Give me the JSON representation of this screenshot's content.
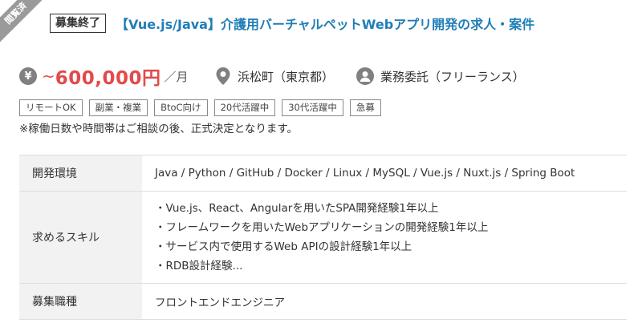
{
  "ribbon": {
    "label": "閲覧済"
  },
  "header": {
    "closed_badge": "募集終了",
    "title": "【Vue.js/Java】介護用バーチャルペットWebアプリ開発の求人・案件"
  },
  "meta": {
    "currency_icon_glyph": "¥",
    "salary_prefix": "~",
    "salary_amount": "600,000円",
    "salary_unit": "／月",
    "location": "浜松町（東京都）",
    "contract_type": "業務委託（フリーランス）",
    "icons": [
      "yen-icon",
      "location-pin-icon",
      "person-icon"
    ]
  },
  "tags": [
    "リモートOK",
    "副業・複業",
    "BtoC向け",
    "20代活躍中",
    "30代活躍中",
    "急募"
  ],
  "note": "※稼働日数や時間帯はご相談の後、正式決定となります。",
  "spec": {
    "environment_label": "開発環境",
    "environment_value": "Java / Python / GitHub / Docker / Linux / MySQL / Vue.js / Nuxt.js / Spring Boot",
    "skills_label": "求めるスキル",
    "skills": [
      "・Vue.js、React、Angularを用いたSPA開発経験1年以上",
      "・フレームワークを用いたWebアプリケーションの開発経験1年以上",
      "・サービス内で使用するWeb APIの設計経験1年以上",
      "・RDB設計経験..."
    ],
    "role_label": "募集職種",
    "role_value": "フロントエンドエンジニア"
  },
  "colors": {
    "title": "#1f7db6",
    "salary": "#e14b4b",
    "icon": "#808080",
    "ribbon": "#9a9a9a",
    "label_bg": "#f2f2f2"
  }
}
